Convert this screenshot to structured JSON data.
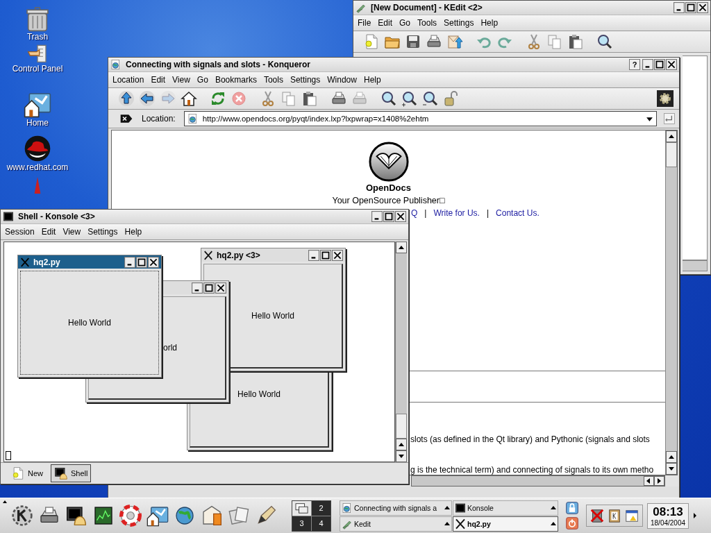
{
  "desktop_icons": [
    {
      "label": "Trash",
      "kind": "trash"
    },
    {
      "label": "Control Panel",
      "kind": "control"
    },
    {
      "label": "Home",
      "kind": "home"
    },
    {
      "label": "www.redhat.com",
      "kind": "redhat"
    },
    {
      "kind": "star"
    }
  ],
  "kedit": {
    "title": "[New Document] - KEdit <2>",
    "menu": [
      "File",
      "Edit",
      "Go",
      "Tools",
      "Settings",
      "Help"
    ]
  },
  "konqueror": {
    "title": "Connecting with signals and slots - Konqueror",
    "help_button": "?",
    "menu": [
      "Location",
      "Edit",
      "View",
      "Go",
      "Bookmarks",
      "Tools",
      "Settings",
      "Window",
      "Help"
    ],
    "location_label": "Location:",
    "url": "http://www.opendocs.org/pyqt/index.lxp?lxpwrap=x1408%2ehtm",
    "page": {
      "site_name": "OpenDocs",
      "tagline": "Your OpenSource Publisher□",
      "links": [
        "Q",
        "Write for Us.",
        "Contact Us."
      ],
      "separators": [
        "|",
        "|"
      ],
      "lines": [
        "slots (as defined in the Qt library) and Pythonic (signals and slots",
        "g is the technical term) and connecting of signals to its own metho"
      ]
    }
  },
  "konsole": {
    "title": "Shell - Konsole <3>",
    "menu": [
      "Session",
      "Edit",
      "View",
      "Settings",
      "Help"
    ],
    "windows": [
      {
        "title": "hq2.py",
        "text": "Hello World",
        "active": true
      },
      {
        "title": "hq2.py <3>",
        "text": "Hello World",
        "active": false
      },
      {
        "text": "orld",
        "active": false
      },
      {
        "text": "Hello World",
        "active": false
      }
    ],
    "new_button": "New",
    "tabs": [
      {
        "label": "Shell",
        "selected": true
      }
    ]
  },
  "taskbar": {
    "pager": [
      {
        "selected": true
      },
      {
        "label": "2",
        "selected": false
      },
      {
        "label": "3",
        "selected": false
      },
      {
        "label": "4",
        "selected": false
      }
    ],
    "tasks": [
      {
        "label": "Connecting with signals a",
        "kind": "browser",
        "selected": false
      },
      {
        "label": "Konsole",
        "kind": "terminal",
        "selected": false
      },
      {
        "label": "Kedit",
        "kind": "editor",
        "selected": false
      },
      {
        "label": "hq2.py",
        "kind": "x",
        "selected": true
      }
    ],
    "clock": {
      "time": "08:13",
      "date": "18/04/2004"
    }
  }
}
